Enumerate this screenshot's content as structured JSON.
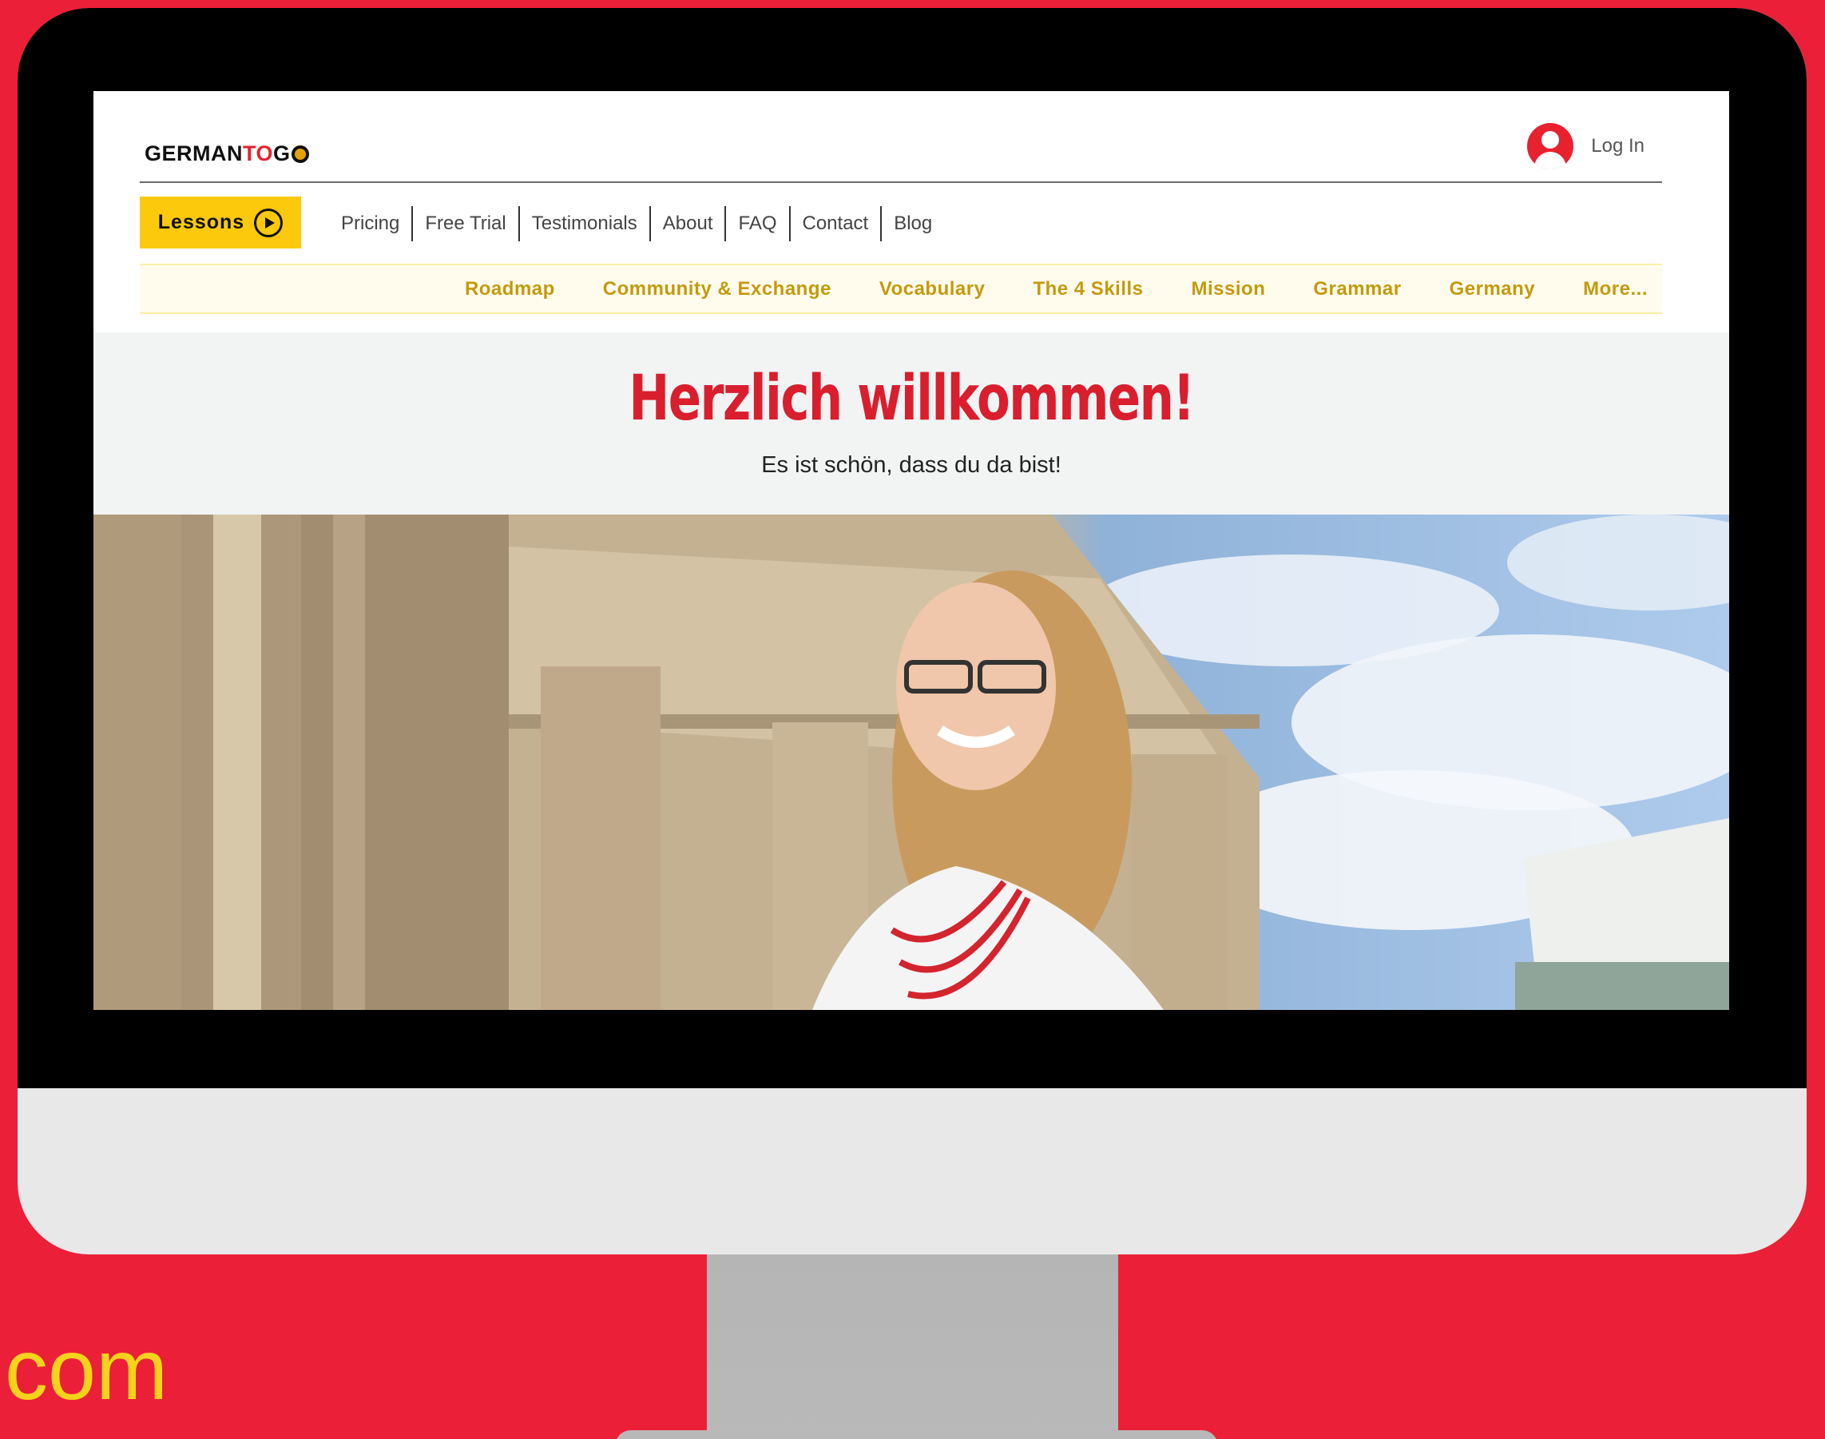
{
  "colors": {
    "background": "#ec1f38",
    "brand_red": "#e8212f",
    "accent_yellow": "#fcc90c",
    "subnav_gold": "#c49a0c"
  },
  "header": {
    "logo": {
      "part1": "GERMAN",
      "part2": "TO",
      "part3": "G"
    },
    "login_label": "Log In"
  },
  "mainnav": {
    "lessons_label": "Lessons",
    "items": [
      "Pricing",
      "Free Trial",
      "Testimonials",
      "About",
      "FAQ",
      "Contact",
      "Blog"
    ]
  },
  "subnav": {
    "items": [
      "Roadmap",
      "Community & Exchange",
      "Vocabulary",
      "The 4 Skills",
      "Mission",
      "Grammar",
      "Germany",
      "More..."
    ]
  },
  "hero": {
    "title": "Herzlich willkommen!",
    "subtitle": "Es ist schön, dass du da bist!"
  },
  "promo": {
    "text": "com"
  }
}
